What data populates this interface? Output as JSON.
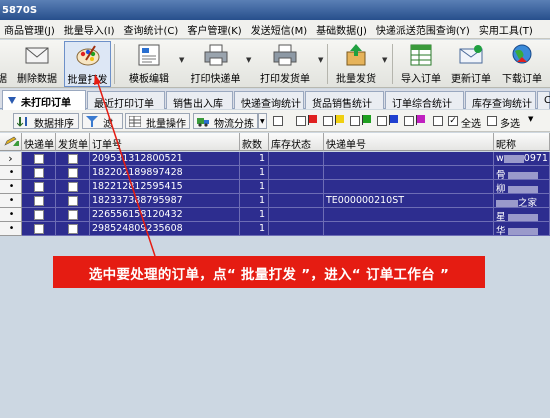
{
  "window": {
    "title": "5870S"
  },
  "menu": [
    "商品管理(J)",
    "批量导入(I)",
    "查询统计(C)",
    "客户管理(K)",
    "发送短信(M)",
    "基础数据(J)",
    "快递派送范围查询(Y)",
    "实用工具(T)"
  ],
  "toolbar": {
    "items": [
      {
        "label": "据"
      },
      {
        "label": "删除数据"
      },
      {
        "label": "批量打发"
      },
      {
        "label": "模板编辑"
      },
      {
        "label": "打印快递单"
      },
      {
        "label": "打印发货单"
      },
      {
        "label": "批量发货"
      },
      {
        "label": "导入订单"
      },
      {
        "label": "更新订单"
      },
      {
        "label": "下载订单"
      }
    ]
  },
  "tabs": [
    "未打印订单",
    "最近打印订单",
    "销售出入库",
    "快递查询统计",
    "货品销售统计",
    "订单综合统计",
    "库存查询统计",
    "C"
  ],
  "filter": {
    "sort_label": "数据排序",
    "filter_label": "滤查",
    "batch_label": "批量操作",
    "logistics_label": "物流分拣",
    "select_all_label": "全选",
    "multi_select_label": "多选"
  },
  "colors": {
    "flags": [
      "#e02020",
      "#f0d010",
      "#20a020",
      "#2040d0",
      "#c020c0"
    ],
    "row_bg": "#2d2d8f",
    "callout_bg": "#e51c12"
  },
  "grid": {
    "columns": [
      "快递单",
      "发货单",
      "订单号",
      "款数",
      "库存状态",
      "快递单号",
      "昵称"
    ],
    "rows": [
      {
        "order_no": "209531312800521",
        "qty": "1",
        "stock": "",
        "express_no": "",
        "nick_prefix": "w",
        "nick_suffix": "0971"
      },
      {
        "order_no": "182202189897428",
        "qty": "1",
        "stock": "",
        "express_no": "",
        "nick_prefix": "",
        "nick_suffix": "骨"
      },
      {
        "order_no": "182212812595415",
        "qty": "1",
        "stock": "",
        "express_no": "",
        "nick_prefix": "",
        "nick_suffix": "柳"
      },
      {
        "order_no": "182337388795987",
        "qty": "1",
        "stock": "",
        "express_no": "TE000000210ST",
        "nick_prefix": "",
        "nick_suffix": "之家"
      },
      {
        "order_no": "226556158120432",
        "qty": "1",
        "stock": "",
        "express_no": "",
        "nick_prefix": "",
        "nick_suffix": "星"
      },
      {
        "order_no": "298524809235608",
        "qty": "1",
        "stock": "",
        "express_no": "",
        "nick_prefix": "",
        "nick_suffix": "华"
      }
    ]
  },
  "annotation": {
    "text": "选中要处理的订单，点“ 批量打发 ”，进入“ 订单工作台 ”"
  }
}
